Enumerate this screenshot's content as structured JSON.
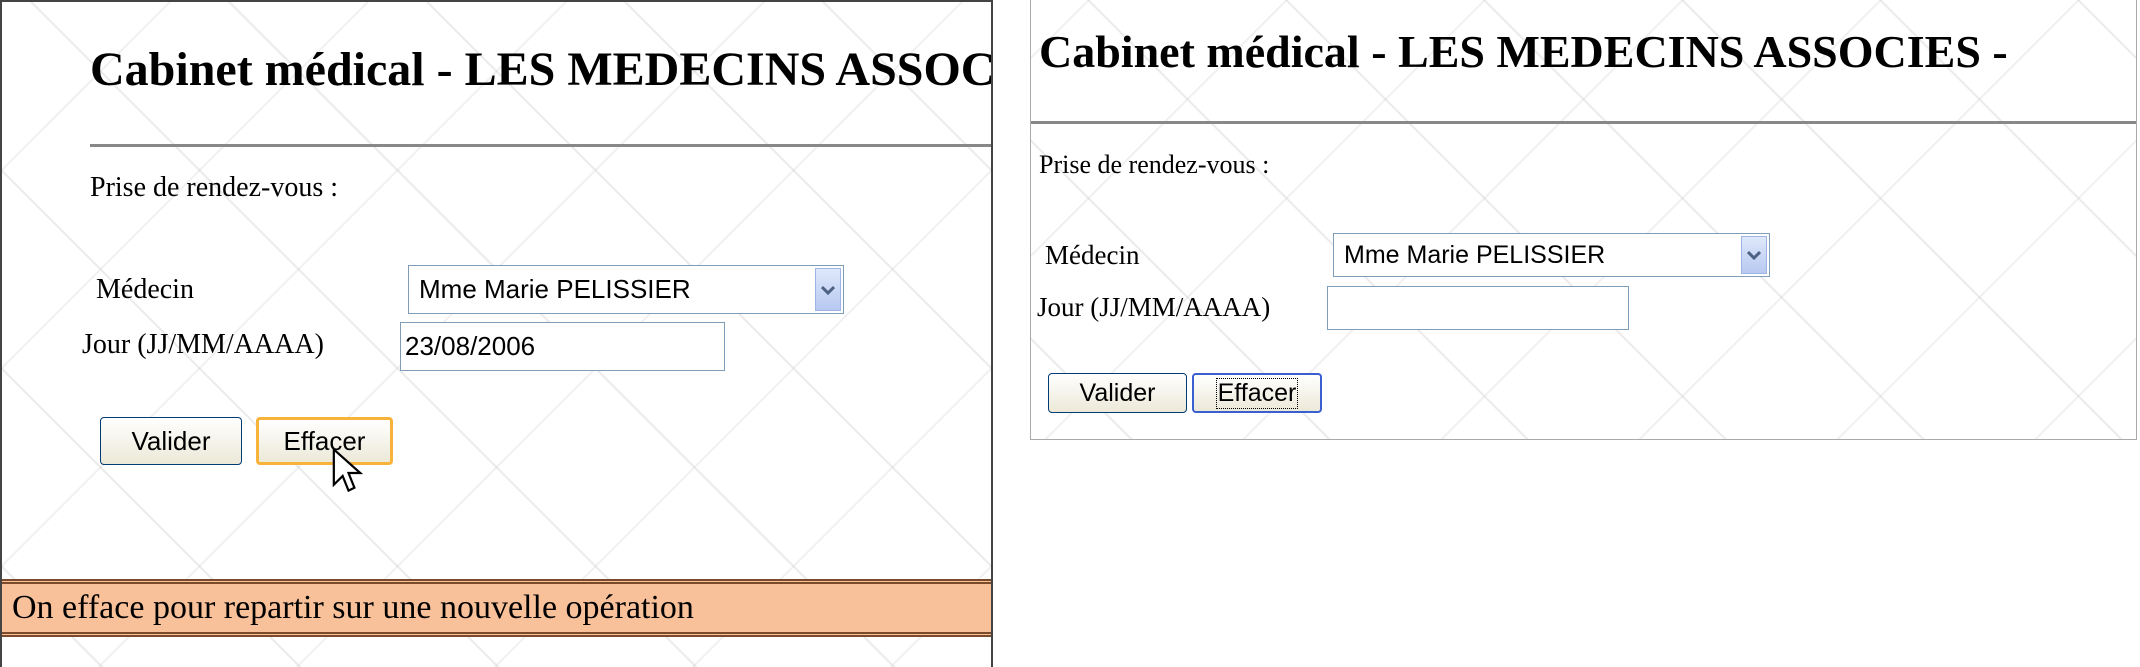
{
  "left": {
    "title": "Cabinet médical - LES MEDECINS ASSOCIES -",
    "section_label": "Prise de rendez-vous :",
    "medecin_label": "Médecin",
    "medecin_value": "Mme Marie PELISSIER",
    "jour_label": "Jour (JJ/MM/AAAA)",
    "jour_value": "23/08/2006",
    "valider_label": "Valider",
    "effacer_label": "Effacer",
    "caption": "On efface pour repartir sur une nouvelle opération"
  },
  "right": {
    "title": "Cabinet médical - LES MEDECINS ASSOCIES -",
    "section_label": "Prise de rendez-vous :",
    "medecin_label": "Médecin",
    "medecin_value": "Mme Marie PELISSIER",
    "jour_label": "Jour (JJ/MM/AAAA)",
    "jour_value": "",
    "valider_label": "Valider",
    "effacer_label": "Effacer"
  },
  "icons": {
    "dropdown": "chevron-down-icon",
    "cursor": "mouse-pointer-icon"
  }
}
